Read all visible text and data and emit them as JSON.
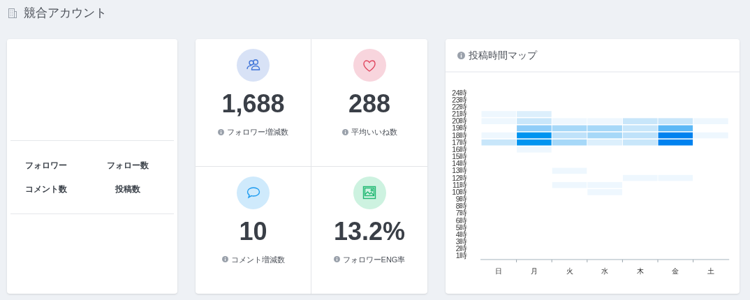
{
  "page_title": "競合アカウント",
  "account_card": {
    "rows": [
      [
        "フォロワー",
        "フォロー数"
      ],
      [
        "コメント数",
        "投稿数"
      ]
    ]
  },
  "stats": [
    {
      "kind": "followers",
      "value": "1,688",
      "label": "フォロワー増減数"
    },
    {
      "kind": "likes",
      "value": "288",
      "label": "平均いいね数"
    },
    {
      "kind": "comments",
      "value": "10",
      "label": "コメント増減数"
    },
    {
      "kind": "engagement",
      "value": "13.2%",
      "label": "フォロワーENG率"
    }
  ],
  "post_time_map": {
    "title": "投稿時間マップ",
    "hour_labels": [
      "24時",
      "23時",
      "22時",
      "21時",
      "20時",
      "19時",
      "18時",
      "17時",
      "16時",
      "15時",
      "14時",
      "13時",
      "12時",
      "11時",
      "10時",
      "9時",
      "8時",
      "7時",
      "6時",
      "5時",
      "4時",
      "3時",
      "2時",
      "1時"
    ],
    "day_labels": [
      "日",
      "月",
      "火",
      "水",
      "木",
      "金",
      "土"
    ]
  }
}
